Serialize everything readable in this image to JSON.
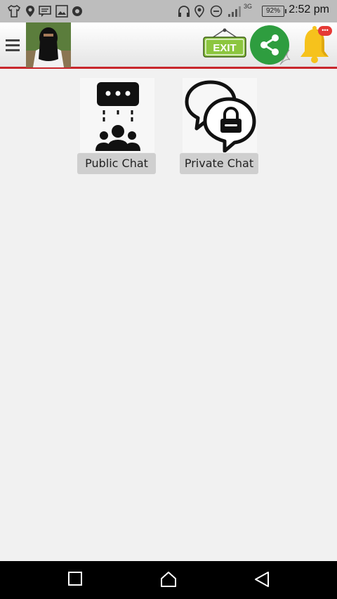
{
  "status_bar": {
    "time": "2:52 pm",
    "battery": "92%",
    "network": "3G"
  },
  "app_bar": {
    "exit_label": "EXIT",
    "notification_badge": "•••"
  },
  "tiles": [
    {
      "label": "Public Chat",
      "icon": "group-chat-icon"
    },
    {
      "label": "Private Chat",
      "icon": "lock-chat-icon"
    }
  ],
  "colors": {
    "accent_line": "#c8262b",
    "exit_green": "#8cc63f",
    "share_green": "#2e9d3f",
    "bell_yellow": "#f6c21c",
    "badge_red": "#e53935"
  }
}
